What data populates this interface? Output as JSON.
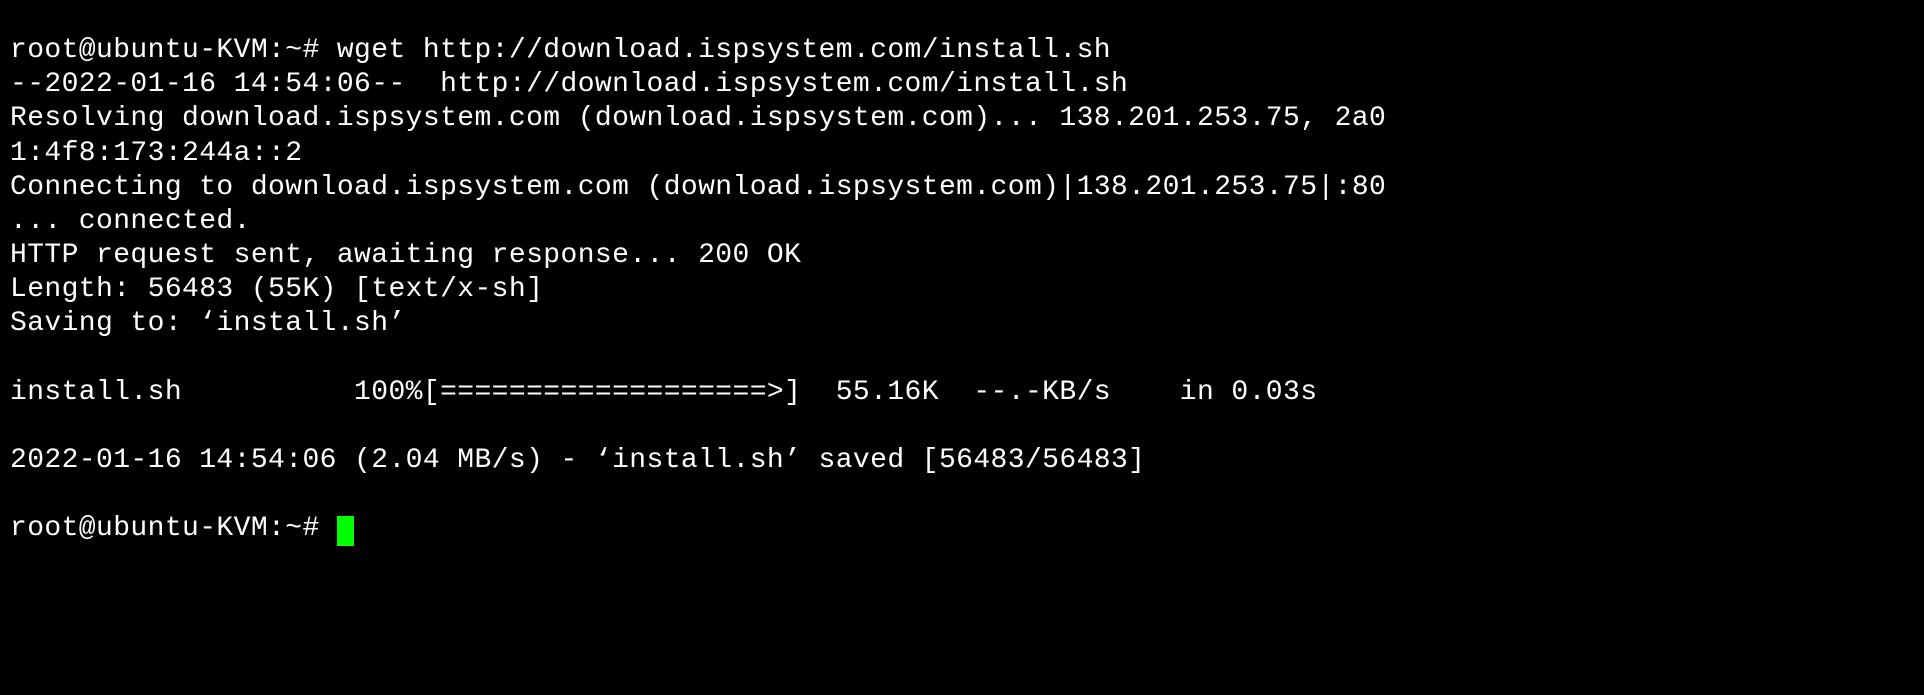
{
  "terminal": {
    "lines": [
      "root@ubuntu-KVM:~# wget http://download.ispsystem.com/install.sh",
      "--2022-01-16 14:54:06--  http://download.ispsystem.com/install.sh",
      "Resolving download.ispsystem.com (download.ispsystem.com)... 138.201.253.75, 2a0",
      "1:4f8:173:244a::2",
      "Connecting to download.ispsystem.com (download.ispsystem.com)|138.201.253.75|:80",
      "... connected.",
      "HTTP request sent, awaiting response... 200 OK",
      "Length: 56483 (55K) [text/x-sh]",
      "Saving to: ‘install.sh’",
      "",
      "install.sh          100%[===================>]  55.16K  --.-KB/s    in 0.03s",
      "",
      "2022-01-16 14:54:06 (2.04 MB/s) - ‘install.sh’ saved [56483/56483]",
      ""
    ],
    "prompt": "root@ubuntu-KVM:~# "
  }
}
